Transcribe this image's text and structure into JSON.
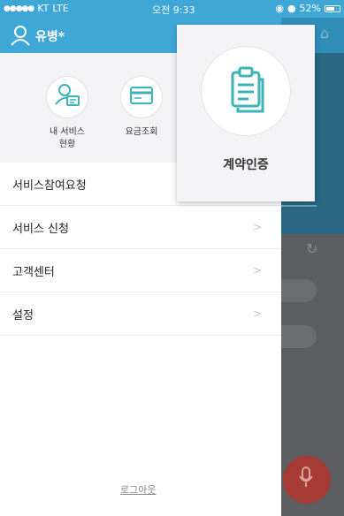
{
  "status_bar": {
    "carrier": "KT",
    "network": "LTE",
    "time": "오전 9:33",
    "battery": "52%"
  },
  "drawer": {
    "user_name": "유병*",
    "quick_actions": [
      {
        "label": "내 서비스\n현황",
        "icon": "user-card-icon"
      },
      {
        "label": "요금조회",
        "icon": "credit-card-icon"
      }
    ],
    "menu_items": [
      {
        "label": "서비스참여요청",
        "has_chevron": false
      },
      {
        "label": "서비스 신청",
        "has_chevron": true
      },
      {
        "label": "고객센터",
        "has_chevron": true
      },
      {
        "label": "설정",
        "has_chevron": true
      }
    ],
    "chevron": ">",
    "logout_label": "로그아웃"
  },
  "popup": {
    "label": "계약인증",
    "icon": "clipboard-document-icon"
  },
  "colors": {
    "header_blue": "#3fa7d6",
    "icon_teal": "#3bb3b7",
    "mic_red": "#a63a34"
  }
}
